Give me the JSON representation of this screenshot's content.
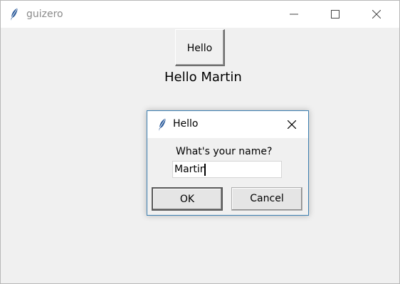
{
  "window": {
    "title": "guizero",
    "icon": "feather-icon",
    "controls": [
      "minimize-icon",
      "maximize-icon",
      "close-icon"
    ]
  },
  "main": {
    "button_label": "Hello",
    "greeting": "Hello Martin"
  },
  "dialog": {
    "title": "Hello",
    "icon": "feather-icon",
    "prompt": "What's your name?",
    "input_value": "Martin",
    "ok_label": "OK",
    "cancel_label": "Cancel"
  }
}
